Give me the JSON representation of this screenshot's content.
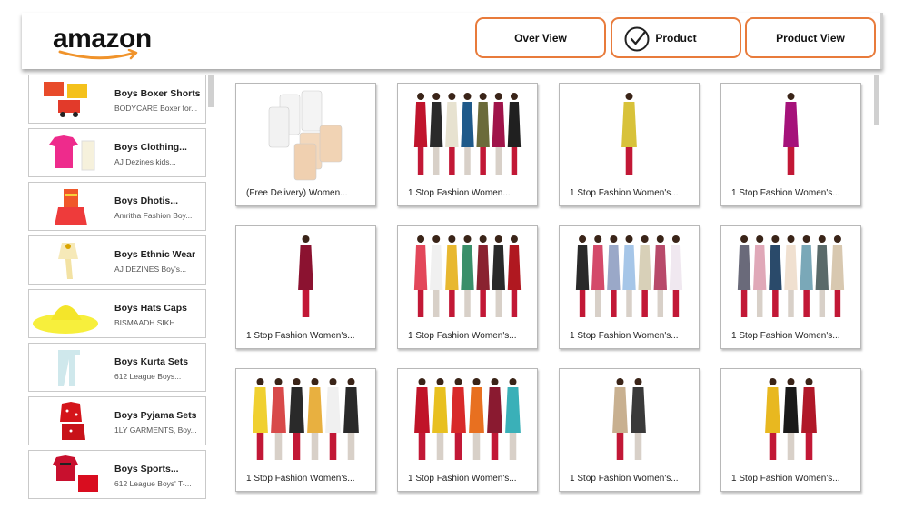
{
  "brand": {
    "name": "amazon"
  },
  "nav": {
    "overview_label": "Over View",
    "product_label": "Product",
    "product_view_label": "Product View",
    "accent": "#e87b3b"
  },
  "sidebar": {
    "items": [
      {
        "title": "Boys Boxer Shorts",
        "subtitle": "BODYCARE Boxer for..."
      },
      {
        "title": "Boys Clothing...",
        "subtitle": "AJ Dezines kids..."
      },
      {
        "title": "Boys Dhotis...",
        "subtitle": "Amritha Fashion Boy..."
      },
      {
        "title": "Boys Ethnic Wear",
        "subtitle": "AJ DEZINES Boy's..."
      },
      {
        "title": "Boys Hats Caps",
        "subtitle": "BISMAADH SIKH..."
      },
      {
        "title": "Boys Kurta Sets",
        "subtitle": "612 League Boys..."
      },
      {
        "title": "Boys Pyjama Sets",
        "subtitle": "1LY GARMENTS, Boy..."
      },
      {
        "title": "Boys Sports...",
        "subtitle": "612 League Boys' T-..."
      }
    ]
  },
  "products": [
    {
      "label": "(Free Delivery) Women..."
    },
    {
      "label": "1 Stop Fashion Women..."
    },
    {
      "label": "1 Stop Fashion Women's..."
    },
    {
      "label": "1 Stop Fashion Women's..."
    },
    {
      "label": "1 Stop Fashion Women's..."
    },
    {
      "label": "1 Stop Fashion Women's..."
    },
    {
      "label": "1 Stop Fashion Women's..."
    },
    {
      "label": "1 Stop Fashion Women's..."
    },
    {
      "label": "1 Stop Fashion Women's..."
    },
    {
      "label": "1 Stop Fashion Women's..."
    },
    {
      "label": "1 Stop Fashion Women's..."
    },
    {
      "label": "1 Stop Fashion Women's..."
    }
  ]
}
